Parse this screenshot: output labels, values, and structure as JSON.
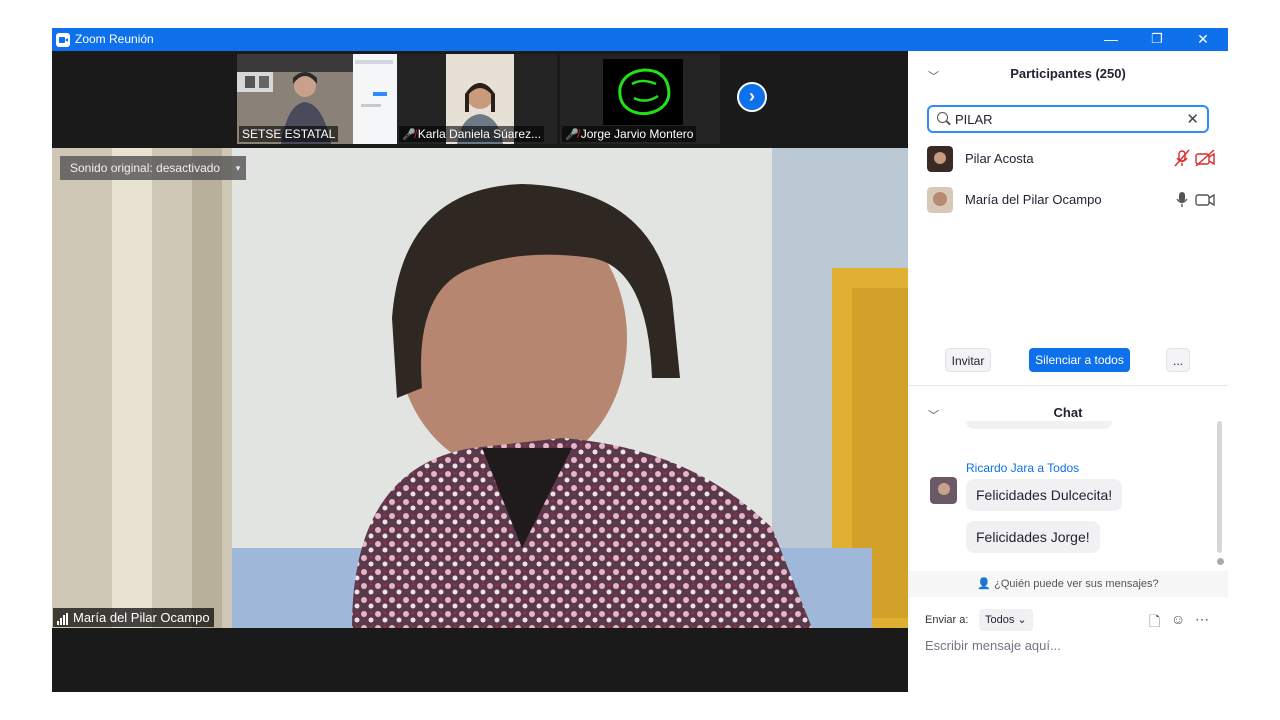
{
  "window": {
    "title": "Zoom Reunión",
    "controls": {
      "minimize": "—",
      "restore": "❐",
      "close": "✕"
    }
  },
  "gallery": {
    "tiles": [
      {
        "name": "SETSE ESTATAL",
        "muted": false
      },
      {
        "name": "Karla Daniela  Súarez...",
        "muted": true
      },
      {
        "name": "Jorge Jarvio Montero",
        "muted": true
      }
    ],
    "next_arrow": "›"
  },
  "main_video": {
    "sound_toggle": "Sonido original: desactivado",
    "sound_caret": "▾",
    "speaker_name": "María del Pilar Ocampo"
  },
  "participants": {
    "header": "Participantes (250)",
    "search_value": "PILAR",
    "clear": "✕",
    "list": [
      {
        "name": "Pilar Acosta",
        "mic_muted": true,
        "video_off": true
      },
      {
        "name": "María del Pilar Ocampo",
        "mic_muted": false,
        "video_off": false
      }
    ],
    "buttons": {
      "invite": "Invitar",
      "mute_all": "Silenciar a todos",
      "more": "..."
    }
  },
  "chat": {
    "header": "Chat",
    "messages": [
      {
        "sender": "Ricardo Jara a Todos",
        "texts": [
          "Felicidades Dulcecita!",
          "Felicidades Jorge!"
        ]
      }
    ],
    "who_can_see": "¿Quién puede ver sus mensajes?",
    "send_to_label": "Enviar a:",
    "send_to_value": "Todos",
    "input_placeholder": "Escribir mensaje aquí..."
  },
  "colors": {
    "accent": "#0e71eb",
    "muted_red": "#e02828",
    "video_bg": "#1a1a1a"
  }
}
